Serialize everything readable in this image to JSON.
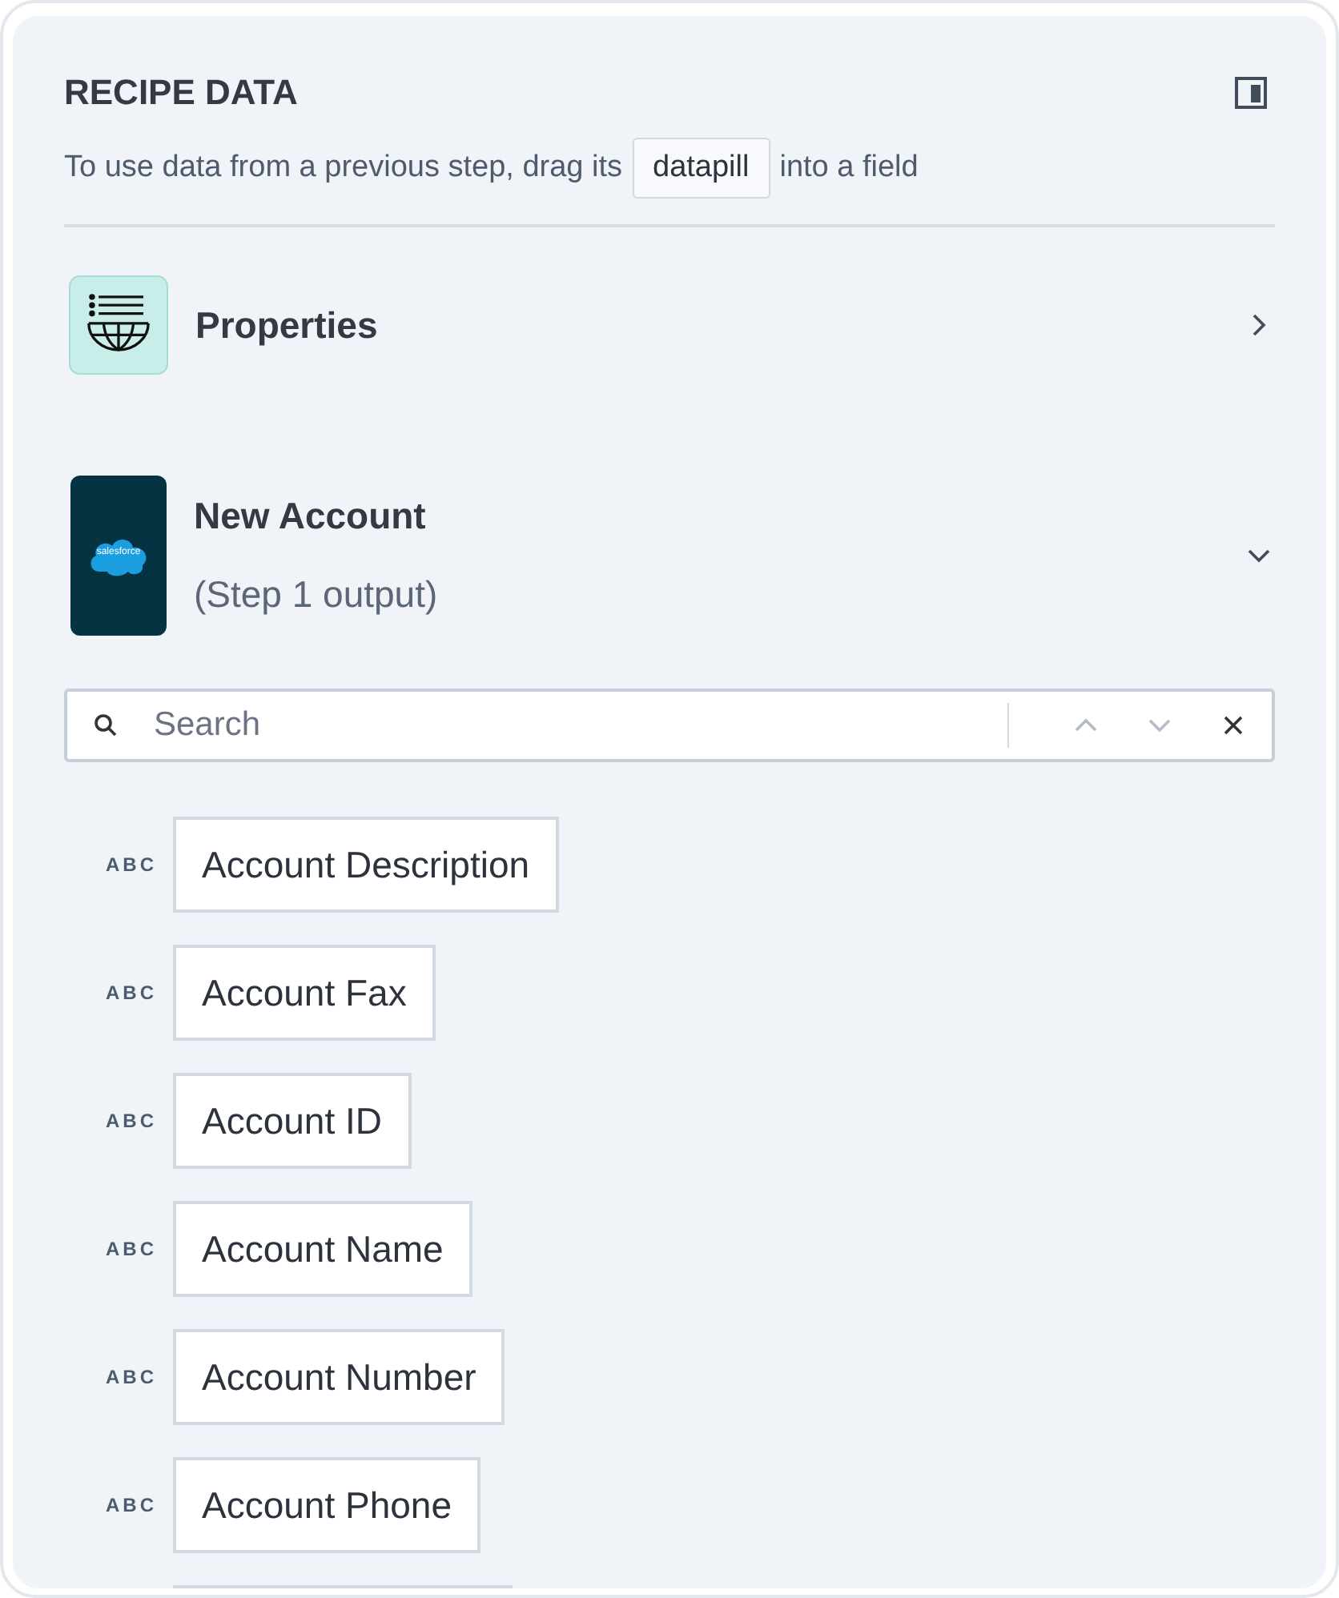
{
  "panel": {
    "title": "RECIPE DATA",
    "hint_before": "To use data from a previous step, drag its",
    "hint_pill": "datapill",
    "hint_after": "into a field"
  },
  "sections": [
    {
      "kind": "properties",
      "title": "Properties",
      "expanded": false
    },
    {
      "kind": "app",
      "title": "New Account",
      "subtitle": "(Step 1 output)",
      "logo_text": "salesforce",
      "expanded": true
    }
  ],
  "search": {
    "placeholder": "Search"
  },
  "fields": [
    {
      "type": "ABC",
      "label": "Account Description"
    },
    {
      "type": "ABC",
      "label": "Account Fax"
    },
    {
      "type": "ABC",
      "label": "Account ID"
    },
    {
      "type": "ABC",
      "label": "Account Name"
    },
    {
      "type": "ABC",
      "label": "Account Number"
    },
    {
      "type": "ABC",
      "label": "Account Phone"
    }
  ]
}
